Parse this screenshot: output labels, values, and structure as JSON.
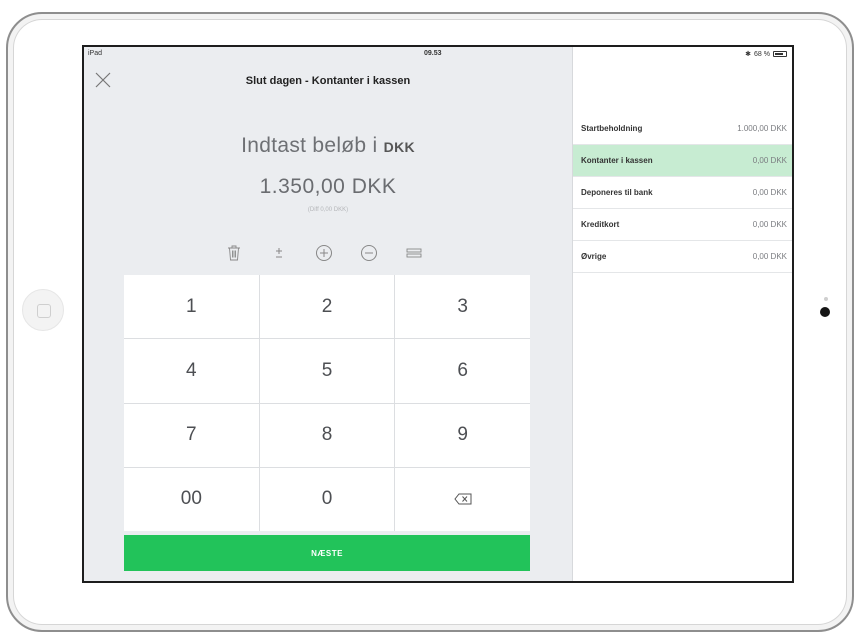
{
  "status": {
    "device": "iPad",
    "time": "09.53",
    "battery": "68 %"
  },
  "header": {
    "title": "Slut dagen - Kontanter i kassen"
  },
  "entry": {
    "prompt": "Indtast beløb i",
    "currency": "DKK",
    "amount": "1.350,00 DKK",
    "diff": "(Diff 0,00 DKK)"
  },
  "tools": [
    "trash-icon",
    "plus-minus-icon",
    "circle-plus-icon",
    "circle-minus-icon",
    "equals-icon"
  ],
  "keypad": {
    "keys": [
      "1",
      "2",
      "3",
      "4",
      "5",
      "6",
      "7",
      "8",
      "9",
      "00",
      "0"
    ]
  },
  "next_button": "NÆSTE",
  "summary": {
    "rows": [
      {
        "label": "Startbeholdning",
        "value": "1.000,00 DKK"
      },
      {
        "label": "Kontanter i kassen",
        "value": "0,00 DKK"
      },
      {
        "label": "Deponeres til bank",
        "value": "0,00 DKK"
      },
      {
        "label": "Kreditkort",
        "value": "0,00 DKK"
      },
      {
        "label": "Øvrige",
        "value": "0,00 DKK"
      }
    ],
    "active_color": "#c7ecd2"
  },
  "colors": {
    "accent": "#22c35a",
    "panel": "#ebedf0"
  }
}
